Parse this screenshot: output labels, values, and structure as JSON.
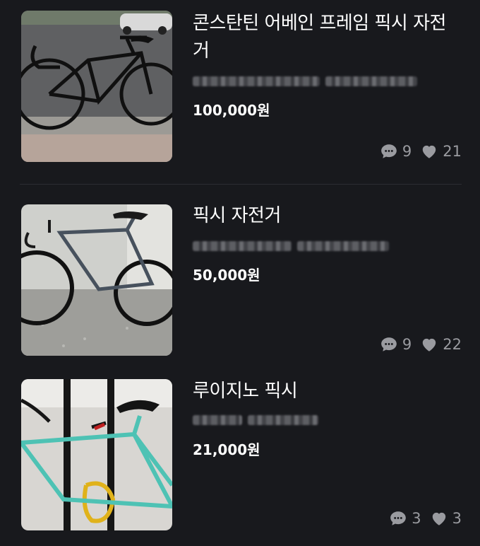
{
  "listings": [
    {
      "title": "콘스탄틴 어베인 프레임 픽시 자전거",
      "price": "100,000원",
      "comments": "9",
      "likes": "21",
      "image": "black-fixie-bike-photo"
    },
    {
      "title": "픽시 자전거",
      "price": "50,000원",
      "comments": "9",
      "likes": "22",
      "image": "gray-fixie-bike-photo"
    },
    {
      "title": "루이지노 픽시",
      "price": "21,000원",
      "comments": "3",
      "likes": "3",
      "image": "mint-fixie-bike-photo"
    }
  ],
  "colors": {
    "background": "#18191d",
    "text": "#ffffff",
    "muted": "#9a9ba0"
  }
}
